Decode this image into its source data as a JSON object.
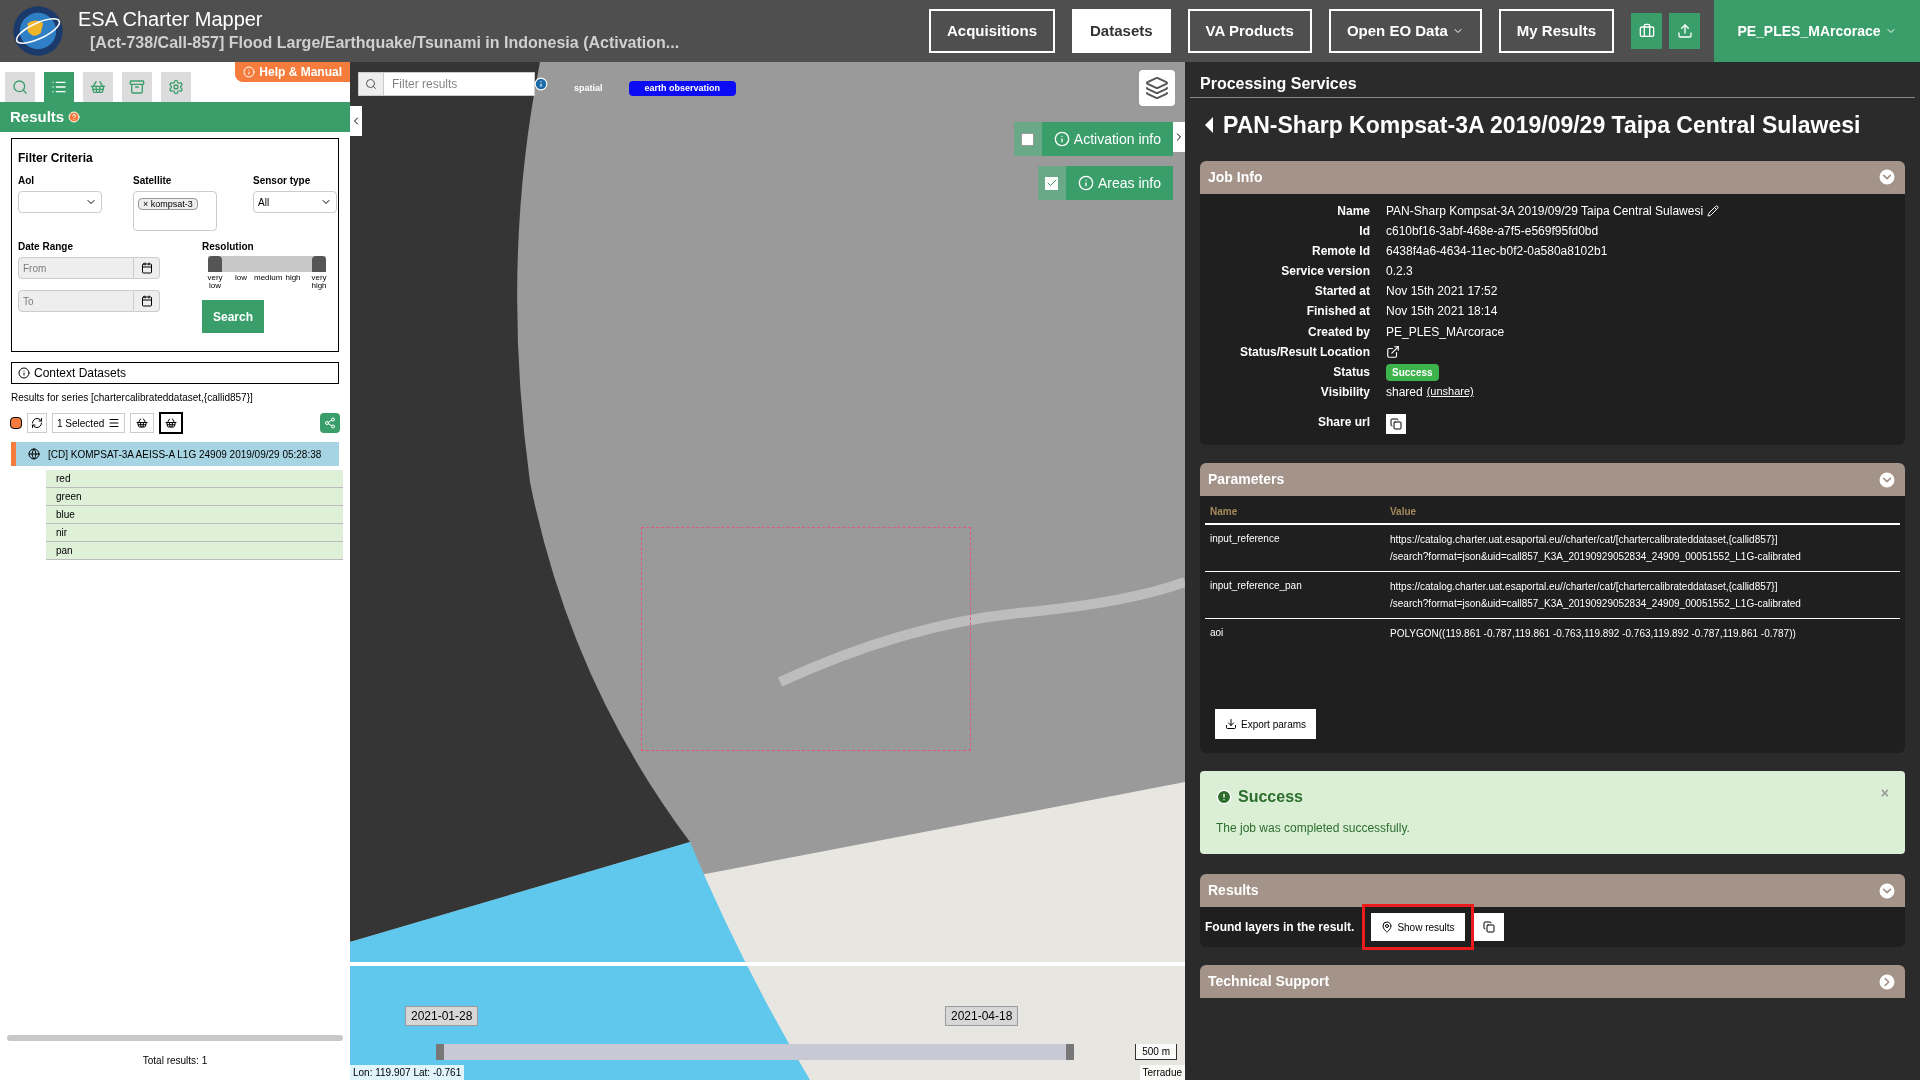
{
  "header": {
    "app_title": "ESA Charter Mapper",
    "activation_title": "[Act-738/Call-857] Flood Large/Earthquake/Tsunami in Indonesia (Activation...",
    "nav": [
      {
        "label": "Acquisitions",
        "selected": false,
        "dropdown": false
      },
      {
        "label": "Datasets",
        "selected": true,
        "dropdown": false
      },
      {
        "label": "VA Products",
        "selected": false,
        "dropdown": false
      },
      {
        "label": "Open EO Data",
        "selected": false,
        "dropdown": true
      },
      {
        "label": "My Results",
        "selected": false,
        "dropdown": false
      }
    ],
    "user": "PE_PLES_MArcorace"
  },
  "left": {
    "tabs": [
      {
        "kind": "search",
        "selected": false
      },
      {
        "kind": "list",
        "selected": true
      },
      {
        "kind": "basket",
        "selected": false
      },
      {
        "kind": "archive",
        "selected": false
      },
      {
        "kind": "settings",
        "selected": false
      }
    ],
    "help": "Help & Manual",
    "section": "Results",
    "filter": {
      "title": "Filter Criteria",
      "aoi_label": "AoI",
      "satellite_label": "Satellite",
      "satellite_chip": "kompsat-3",
      "satellite_chip_remove": "×",
      "sensor_label": "Sensor type",
      "sensor_value": "All",
      "date_label": "Date Range",
      "from_placeholder": "From",
      "to_placeholder": "To",
      "resolution_label": "Resolution",
      "resolution_thumbs": [
        {
          "level": 0
        },
        {
          "level": 1
        }
      ],
      "resolution_ticks": [
        "very low",
        "low",
        "medium",
        "high",
        "very high"
      ],
      "search": "Search"
    },
    "context": "Context Datasets",
    "select_all_checked": true,
    "series_text": "Results for series [chartercalibrateddataset,{callid857}]",
    "selected_count": "1 Selected",
    "datasets": [
      {
        "label": "[CD] KOMPSAT-3A AEISS-A L1G 24909 2019/09/29 05:28:38",
        "selected": true,
        "children": [
          {
            "label": "red"
          },
          {
            "label": "green"
          },
          {
            "label": "blue"
          },
          {
            "label": "nir"
          },
          {
            "label": "pan"
          }
        ]
      }
    ],
    "total": "Total results: 1"
  },
  "map": {
    "filter_placeholder": "Filter results",
    "tags": [
      {
        "label": "spatial",
        "color": "#9a9a9a"
      },
      {
        "label": "earth observation",
        "color": "#0b0bf5"
      }
    ],
    "toggles": [
      {
        "label": "Activation info",
        "checked": false
      },
      {
        "label": "Areas info",
        "checked": true
      }
    ],
    "timeline": {
      "start": {
        "label": "2021-01-28",
        "level": 0
      },
      "end": {
        "label": "2021-04-18",
        "level": 1
      }
    },
    "scale": "500 m",
    "coords": "Lon: 119.907 Lat: -0.761",
    "attribution": "Terradue"
  },
  "right": {
    "heading": "Processing Services",
    "title": "PAN-Sharp Kompsat-3A 2019/09/29 Taipa Central Sulawesi",
    "job_info": {
      "title": "Job Info",
      "expanded": true,
      "rows": [
        {
          "kind": "editable",
          "label": "Name",
          "value": "PAN-Sharp Kompsat-3A 2019/09/29 Taipa Central Sulawesi"
        },
        {
          "kind": "text",
          "label": "Id",
          "value": "c610bf16-3abf-468e-a7f5-e569f95fd0bd"
        },
        {
          "kind": "text",
          "label": "Remote Id",
          "value": "6438f4a6-4634-11ec-b0f2-0a580a8102b1"
        },
        {
          "kind": "text",
          "label": "Service version",
          "value": "0.2.3"
        },
        {
          "kind": "text",
          "label": "Started at",
          "value": "Nov 15th 2021 17:52"
        },
        {
          "kind": "text",
          "label": "Finished at",
          "value": "Nov 15th 2021 18:14"
        },
        {
          "kind": "text",
          "label": "Created by",
          "value": "PE_PLES_MArcorace"
        },
        {
          "kind": "link",
          "label": "Status/Result Location"
        },
        {
          "kind": "badge",
          "label": "Status",
          "value": "Success"
        },
        {
          "kind": "visibility",
          "label": "Visibility",
          "value": "shared",
          "link": "(unshare)"
        },
        {
          "kind": "copy",
          "label": "Share url"
        }
      ]
    },
    "parameters": {
      "title": "Parameters",
      "expanded": true,
      "columns": [
        "Name",
        "Value"
      ],
      "rows": [
        {
          "name": "input_reference",
          "value": [
            "https://catalog.charter.uat.esaportal.eu//charter/cat/[chartercalibrateddataset,{callid857}]",
            "/search?format=json&uid=call857_K3A_20190929052834_24909_00051552_L1G-calibrated"
          ]
        },
        {
          "name": "input_reference_pan",
          "value": [
            "https://catalog.charter.uat.esaportal.eu//charter/cat/[chartercalibrateddataset,{callid857}]",
            "/search?format=json&uid=call857_K3A_20190929052834_24909_00051552_L1G-calibrated"
          ]
        },
        {
          "name": "aoi",
          "value": [
            "POLYGON((119.861 -0.787,119.861 -0.763,119.892 -0.763,119.892 -0.787,119.861 -0.787))"
          ]
        }
      ],
      "export": "Export params"
    },
    "alert": {
      "title": "Success",
      "message": "The job was completed successfully.",
      "close": "×"
    },
    "results": {
      "title": "Results",
      "expanded": true,
      "text": "Found layers in the result.",
      "button": "Show results"
    },
    "support": {
      "title": "Technical Support",
      "expanded": false
    }
  }
}
